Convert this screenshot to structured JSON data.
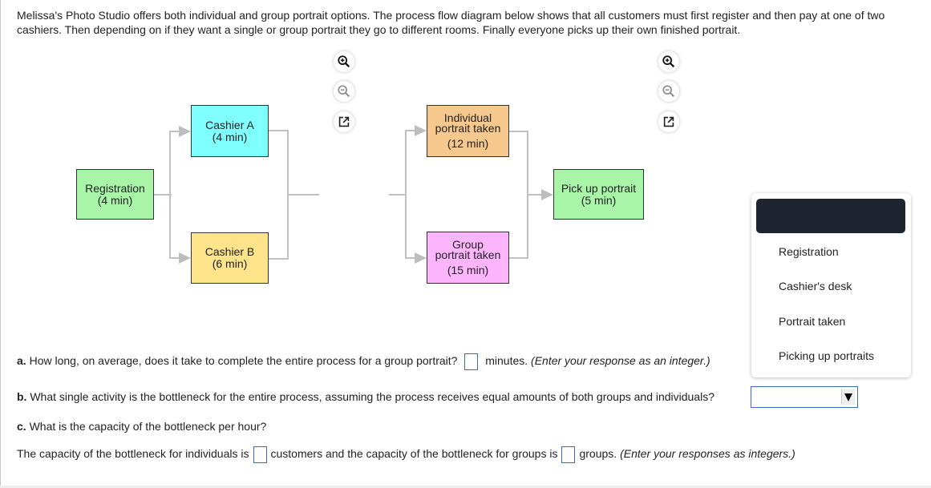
{
  "intro_text": "Melissa's Photo Studio offers both individual and group portrait options. The process flow diagram below shows that all customers must first register and then pay at one of two cashiers. Then depending on if they want a single or group portrait they go to different rooms. Finally everyone picks up their own finished portrait.",
  "diagram": {
    "nodes": {
      "registration": {
        "line1": "Registration",
        "line2": "(4 min)",
        "color": "#a8f5a8"
      },
      "cashier_a": {
        "line1": "Cashier A",
        "line2": "(4 min)",
        "color": "#80ffff"
      },
      "cashier_b": {
        "line1": "Cashier B",
        "line2": "(6 min)",
        "color": "#fde48a"
      },
      "individual": {
        "line1": "Individual",
        "line2": "portrait taken",
        "line3": "(12 min)",
        "color": "#f6c88e"
      },
      "group": {
        "line1": "Group",
        "line2": "portrait taken",
        "line3": "(15 min)",
        "color": "#fdb6fd"
      },
      "pickup": {
        "line1": "Pick up portrait",
        "line2": "(5 min)",
        "color": "#a8f5a8"
      }
    },
    "tools": {
      "zoom_in": "zoom-in",
      "zoom_out": "zoom-out",
      "popout": "open-in-new-window"
    }
  },
  "dropdown": {
    "selected": "",
    "options": [
      "Registration",
      "Cashier's desk",
      "Portrait taken",
      "Picking up portraits"
    ]
  },
  "questions": {
    "a": {
      "label": "a.",
      "text": " How long, on average, does it take to complete the entire process for a group portrait?",
      "value": "",
      "unit": "minutes.",
      "hint": "(Enter your response as an integer.)"
    },
    "b": {
      "label": "b.",
      "text": " What single activity is the bottleneck for the entire process, assuming the process receives equal amounts of both groups and individuals?",
      "value": ""
    },
    "c": {
      "label": "c.",
      "text": " What is the capacity of the bottleneck per hour?",
      "sentence_part1": "The capacity of the bottleneck for individuals is",
      "individuals_value": "",
      "sentence_part2": "customers and the capacity of the bottleneck for groups is",
      "groups_value": "",
      "sentence_part3": "groups.",
      "hint": "(Enter your responses as integers.)"
    }
  }
}
